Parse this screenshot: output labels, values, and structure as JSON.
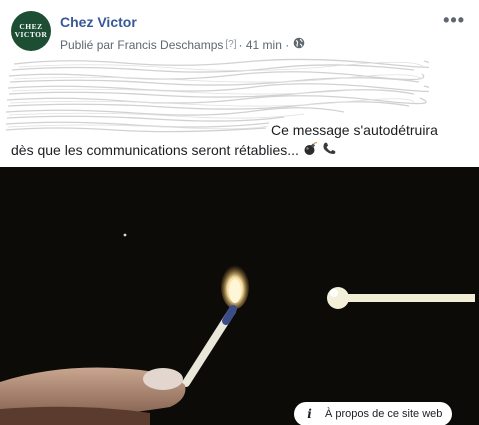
{
  "post": {
    "page_name": "Chez Victor",
    "avatar_line1": "CHEZ",
    "avatar_line2": "VICTOR",
    "meta_prefix": "Publié par Francis Deschamps",
    "meta_help": "[?]",
    "meta_time": "· 41 min ·",
    "privacy_icon": "globe-icon",
    "more_label": "•••",
    "text_line1": "Ce message s'autodétruira",
    "text_line2": "dès que les communications seront rétablies...",
    "emojis": [
      "bomb-icon",
      "telephone-icon"
    ],
    "media_description_icon": "info-icon",
    "about_label": "À propos de ce site web"
  }
}
